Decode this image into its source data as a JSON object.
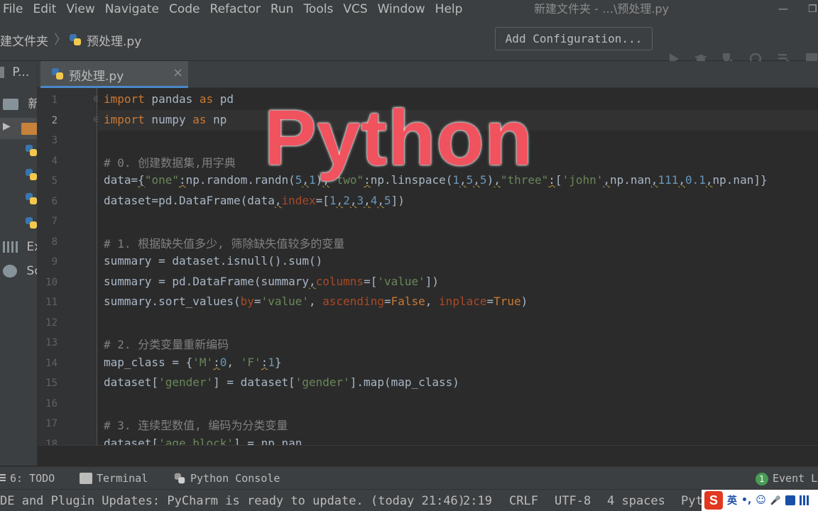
{
  "menu": {
    "items": [
      "File",
      "Edit",
      "View",
      "Navigate",
      "Code",
      "Refactor",
      "Run",
      "Tools",
      "VCS",
      "Window",
      "Help"
    ],
    "window_title": "新建文件夹 - …\\预处理.py"
  },
  "navbar": {
    "breadcrumb_folder": "建文件夹",
    "breadcrumb_file": "预处理.py",
    "add_configuration": "Add Configuration..."
  },
  "sidebar": {
    "project_label": "P...",
    "folder_label": "新",
    "external_label": "Ex",
    "scratches_label": "Sc"
  },
  "tab": {
    "label": "预处理.py",
    "close": "×"
  },
  "editor": {
    "line_numbers": [
      "1",
      "2",
      "3",
      "4",
      "5",
      "6",
      "7",
      "8",
      "9",
      "10",
      "11",
      "12",
      "13",
      "14",
      "15",
      "16",
      "17",
      "18"
    ],
    "current_line": "2"
  },
  "overlay": {
    "text": "Python"
  },
  "toolwindows": {
    "todo": "6: TODO",
    "terminal": "Terminal",
    "python_console": "Python Console",
    "event_count": "1",
    "event_log": "Event Lo"
  },
  "status": {
    "message": "DE and Plugin Updates: PyCharm is ready to update. (today 21:46)",
    "position": "2:19",
    "line_sep": "CRLF",
    "encoding": "UTF-8",
    "indent": "4 spaces",
    "interpreter": "Pyth"
  },
  "ime": {
    "logo": "S",
    "lang": "英",
    "punct": "•,",
    "smile": "☺",
    "mic": "🎤"
  },
  "colors": {
    "keyword": "#cc7832",
    "string": "#6a8759",
    "number": "#6897bb",
    "comment": "#808080",
    "overlay": "#f0525e"
  }
}
